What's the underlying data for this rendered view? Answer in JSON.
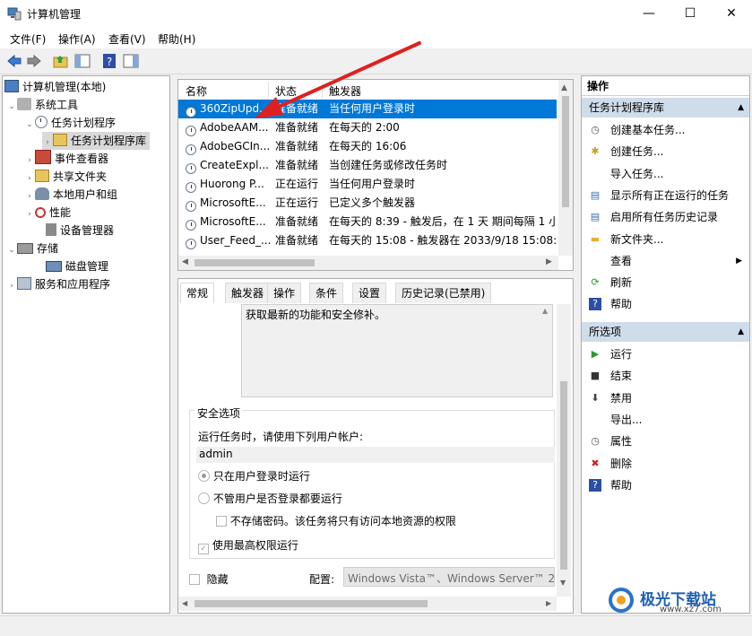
{
  "window": {
    "title": "计算机管理",
    "minimize": "—",
    "maximize": "☐",
    "close": "✕"
  },
  "menu": [
    "文件(F)",
    "操作(A)",
    "查看(V)",
    "帮助(H)"
  ],
  "tree": {
    "root": "计算机管理(本地)",
    "system_tools": "系统工具",
    "task_scheduler": "任务计划程序",
    "task_library": "任务计划程序库",
    "event_viewer": "事件查看器",
    "shared_folders": "共享文件夹",
    "local_users": "本地用户和组",
    "performance": "性能",
    "device_manager": "设备管理器",
    "storage": "存储",
    "disk_management": "磁盘管理",
    "services_apps": "服务和应用程序"
  },
  "tasklist": {
    "columns": {
      "name": "名称",
      "status": "状态",
      "trigger": "触发器"
    },
    "rows": [
      {
        "name": "360ZipUpd...",
        "status": "准备就绪",
        "trigger": "当任何用户登录时"
      },
      {
        "name": "AdobeAAM...",
        "status": "准备就绪",
        "trigger": "在每天的 2:00"
      },
      {
        "name": "AdobeGCIn...",
        "status": "准备就绪",
        "trigger": "在每天的 16:06"
      },
      {
        "name": "CreateExpl...",
        "status": "准备就绪",
        "trigger": "当创建任务或修改任务时"
      },
      {
        "name": "Huorong P...",
        "status": "正在运行",
        "trigger": "当任何用户登录时"
      },
      {
        "name": "MicrosoftE...",
        "status": "正在运行",
        "trigger": "已定义多个触发器"
      },
      {
        "name": "MicrosoftE...",
        "status": "准备就绪",
        "trigger": "在每天的 8:39 - 触发后，在 1 天 期间每隔 1 小"
      },
      {
        "name": "User_Feed_...",
        "status": "准备就绪",
        "trigger": "在每天的 15:08 - 触发器在 2033/9/18 15:08:5"
      }
    ]
  },
  "details": {
    "tabs": [
      "常规",
      "触发器",
      "操作",
      "条件",
      "设置",
      "历史记录(已禁用)"
    ],
    "description": "获取最新的功能和安全修补。",
    "security_title": "安全选项",
    "run_as_label": "运行任务时，请使用下列用户帐户:",
    "account": "admin",
    "opt_logged_on": "只在用户登录时运行",
    "opt_whether": "不管用户是否登录都要运行",
    "opt_no_password": "不存储密码。该任务将只有访问本地资源的权限",
    "opt_highest": "使用最高权限运行",
    "hidden": "隐藏",
    "config_label": "配置:",
    "config_value": "Windows Vista™、Windows Server™ 20"
  },
  "actions": {
    "header": "操作",
    "section1": "任务计划程序库",
    "items1": [
      "创建基本任务...",
      "创建任务...",
      "导入任务...",
      "显示所有正在运行的任务",
      "启用所有任务历史记录",
      "新文件夹...",
      "查看",
      "刷新",
      "帮助"
    ],
    "section2": "所选项",
    "items2": [
      "运行",
      "结束",
      "禁用",
      "导出...",
      "属性",
      "删除",
      "帮助"
    ]
  },
  "watermark": {
    "brand": "极光下载站",
    "url": "www.xz7.com"
  },
  "colors": {
    "selection": "#0078d7",
    "section": "#cfdcea",
    "arrow": "#e02020"
  }
}
